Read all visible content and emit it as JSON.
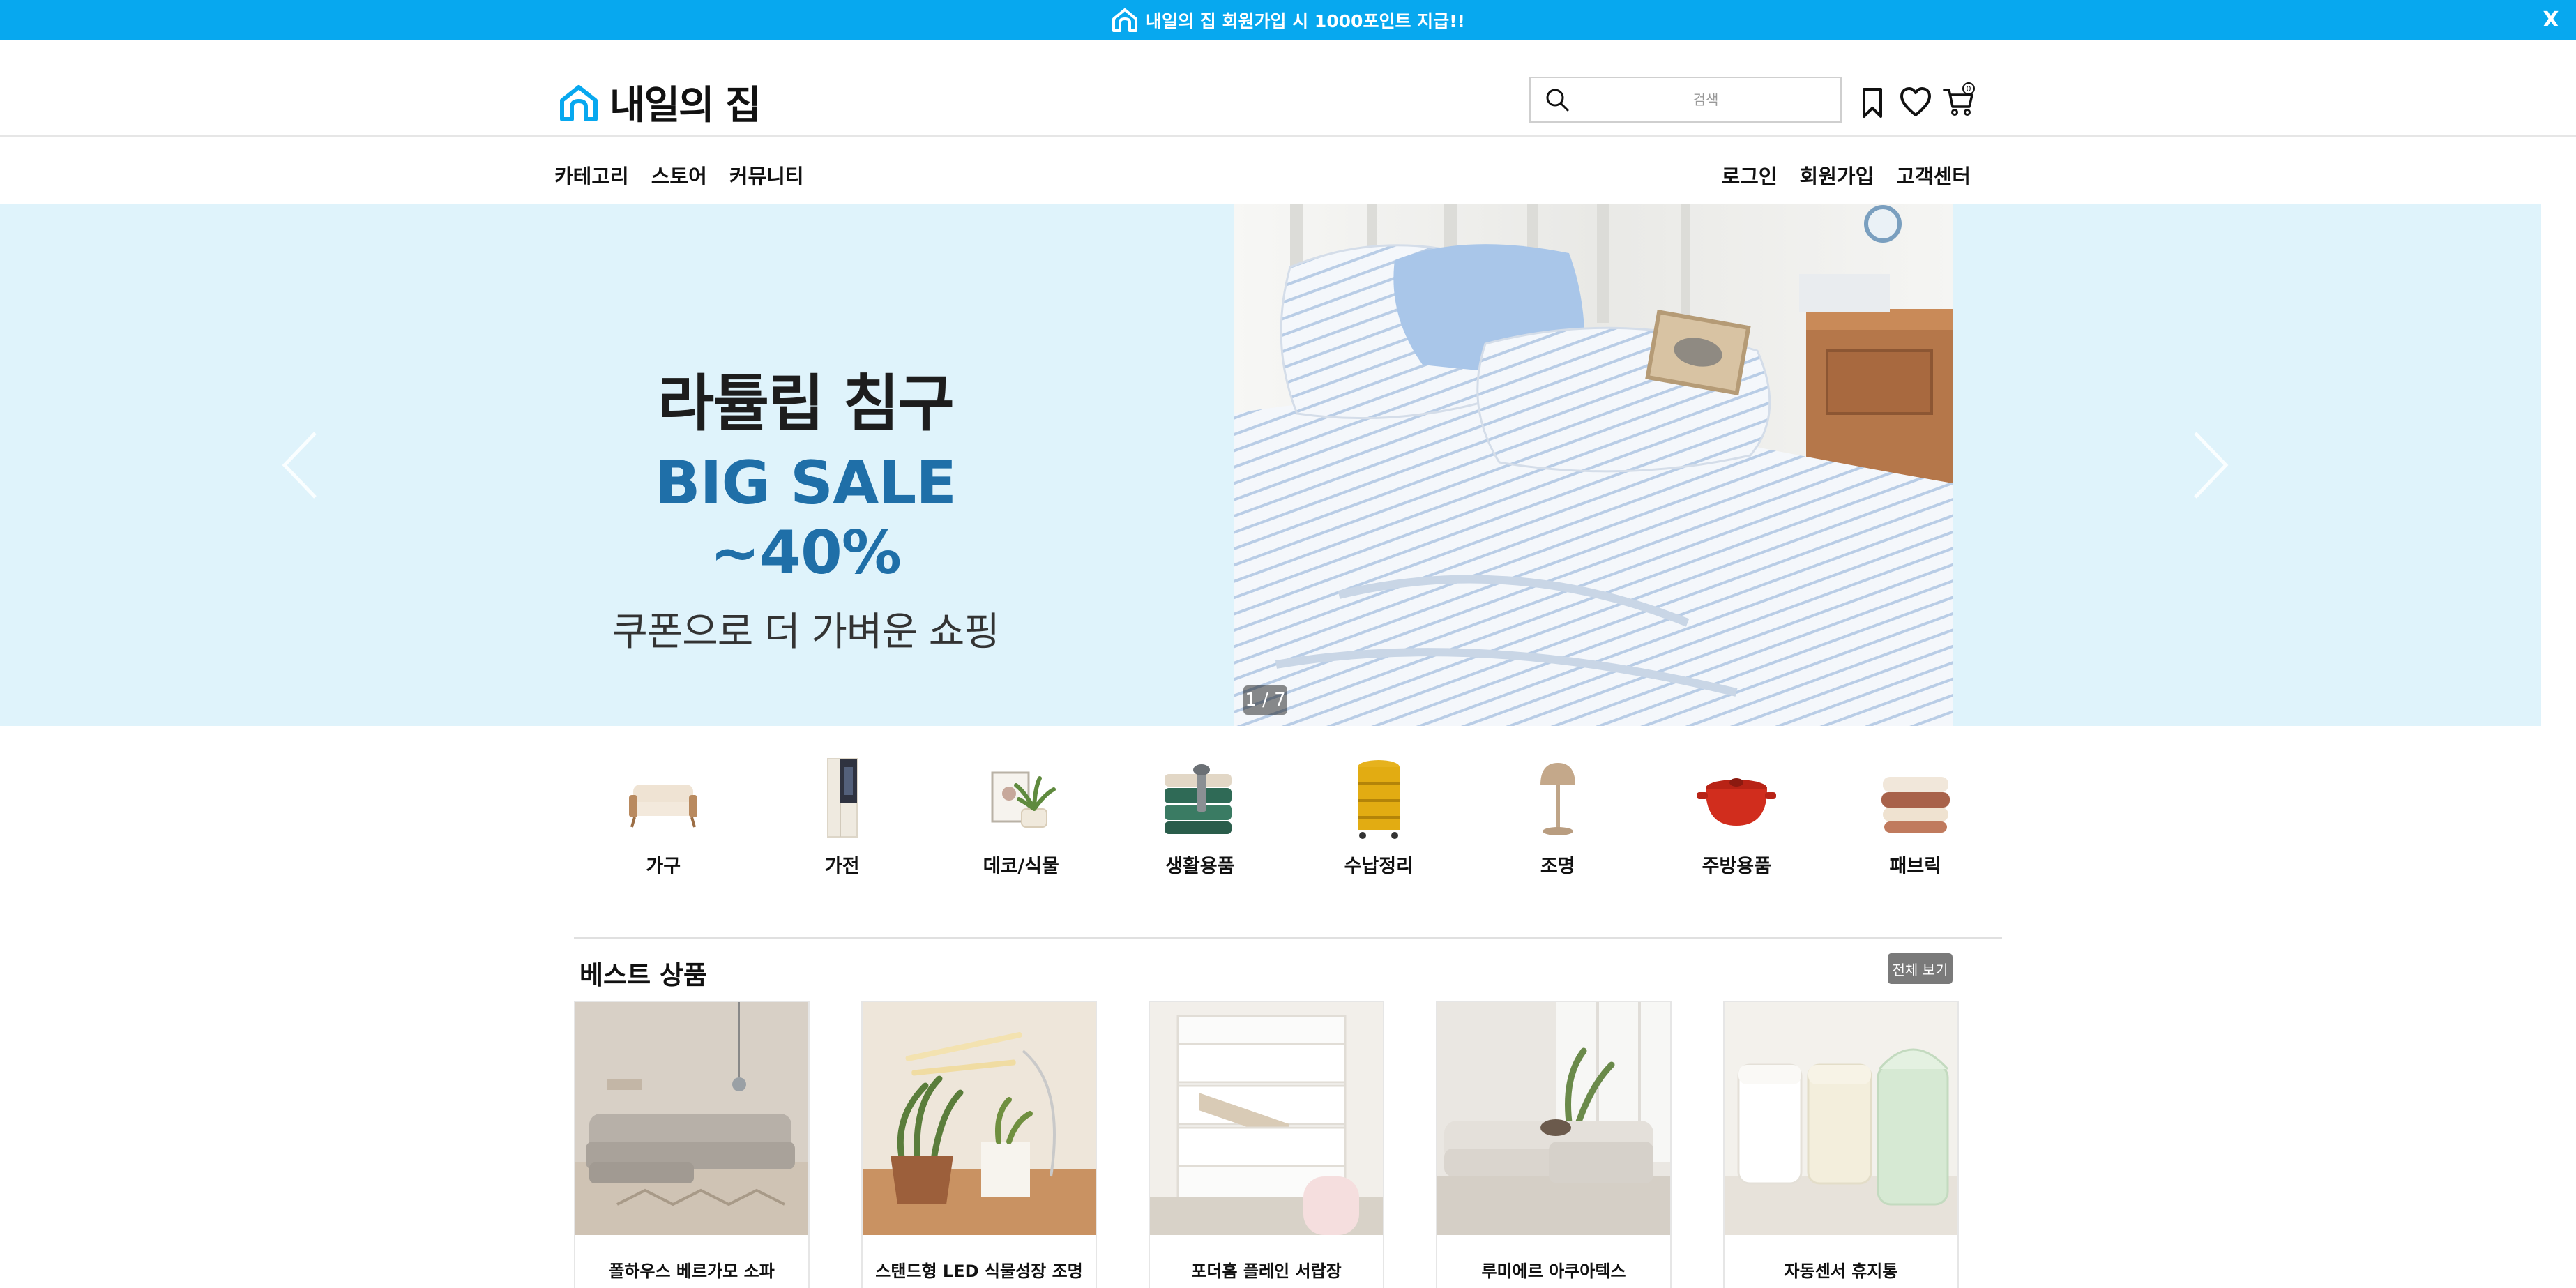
{
  "banner": {
    "text": "내일의 집 회원가입 시 1000포인트 지급!!",
    "close": "X"
  },
  "header": {
    "logo_text": "내일의 집",
    "search_placeholder": "검색",
    "cart_count": "0"
  },
  "nav": {
    "left": [
      "카테고리",
      "스토어",
      "커뮤니티"
    ],
    "right": [
      "로그인",
      "회원가입",
      "고객센터"
    ]
  },
  "hero": {
    "title": "라튤립 침구",
    "sale": "BIG SALE ~40%",
    "subtitle": "쿠폰으로 더 가벼운 쇼핑",
    "counter": "1 / 7"
  },
  "categories": [
    "가구",
    "가전",
    "데코/식물",
    "생활용품",
    "수납정리",
    "조명",
    "주방용품",
    "패브릭"
  ],
  "best": {
    "title": "베스트 상품",
    "see_all": "전체 보기",
    "products": [
      "폴하우스 베르가모 소파",
      "스탠드형 LED 식물성장 조명",
      "포더홈 플레인 서랍장",
      "루미에르 아쿠아텍스",
      "자동센서 휴지통"
    ]
  },
  "colors": {
    "brand": "#07a8ef",
    "hero_bg": "#dff3fb",
    "sale_text": "#1f6fa8"
  }
}
